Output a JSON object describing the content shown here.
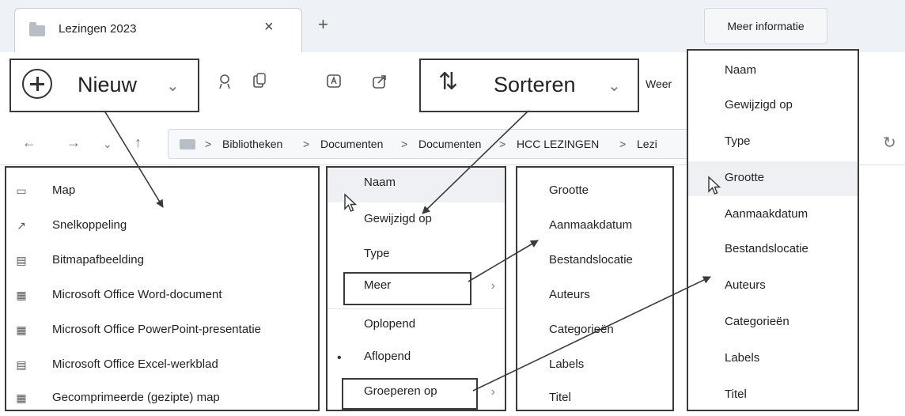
{
  "tab": {
    "title": "Lezingen 2023",
    "close": "×",
    "add": "+"
  },
  "more_info": "Meer informatie",
  "toolbar": {
    "new_label": "Nieuw",
    "chevron": "⌄",
    "sort_label": "Sorteren",
    "view_label_partial": "Weer"
  },
  "breadcrumb": {
    "items": [
      "Bibliotheken",
      "Documenten",
      "Documenten",
      "HCC LEZINGEN",
      "Lezi"
    ],
    "separator": ">"
  },
  "new_menu": {
    "items": [
      {
        "label": "Map",
        "icon": "folder-add-icon"
      },
      {
        "label": "Snelkoppeling",
        "icon": "shortcut-icon"
      },
      {
        "label": "Bitmapafbeelding",
        "icon": "bitmap-icon"
      },
      {
        "label": "Microsoft Office Word-document",
        "icon": "word-icon"
      },
      {
        "label": "Microsoft Office PowerPoint-presentatie",
        "icon": "powerpoint-icon"
      },
      {
        "label": "Microsoft Office Excel-werkblad",
        "icon": "excel-icon"
      },
      {
        "label": "Gecomprimeerde (gezipte) map",
        "icon": "zip-icon"
      }
    ]
  },
  "sort_menu": {
    "items": [
      "Naam",
      "Gewijzigd op",
      "Type",
      "Meer",
      "Oplopend",
      "Aflopend",
      "Groeperen op"
    ],
    "selected": "Aflopend"
  },
  "more_menu": {
    "items": [
      "Grootte",
      "Aanmaakdatum",
      "Bestandslocatie",
      "Auteurs",
      "Categorieën",
      "Labels",
      "Titel"
    ]
  },
  "group_menu": {
    "items": [
      "Naam",
      "Gewijzigd op",
      "Type",
      "Grootte",
      "Aanmaakdatum",
      "Bestandslocatie",
      "Auteurs",
      "Categorieën",
      "Labels",
      "Titel"
    ],
    "highlighted": "Grootte"
  }
}
